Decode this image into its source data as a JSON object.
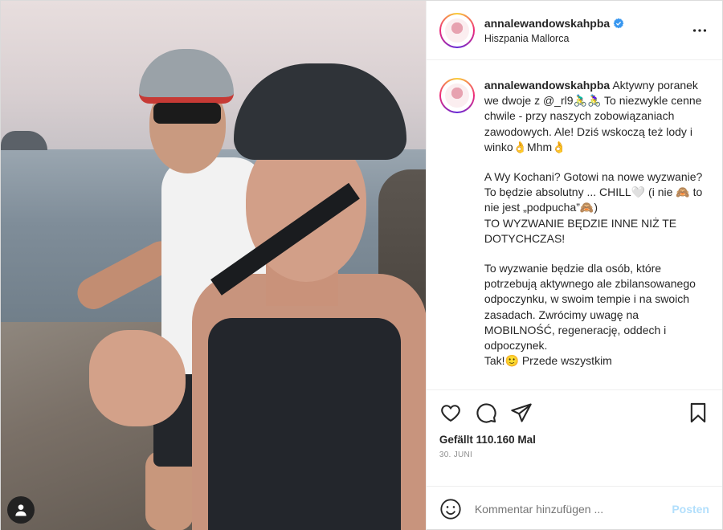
{
  "post": {
    "username": "annalewandowskahpba",
    "location": "Hiszpania Mallorca",
    "verified": true,
    "caption": {
      "username": "annalewandowskahpba",
      "p1": "Aktywny poranek we dwoje z @_rl9🚴‍♂️🚴‍♀️ To niezwykle cenne chwile - przy naszych zobowiązaniach zawodowych. Ale! Dziś wskoczą też lody i winko👌Mhm👌",
      "p2a": "A Wy Kochani? Gotowi na nowe wyzwanie?",
      "p2b": "To będzie absolutny ... CHILL🤍 (i nie 🙈 to nie jest „podpucha”🙈)",
      "p2c": "TO WYZWANIE BĘDZIE INNE NIŻ TE DOTYCHCZAS!",
      "p3": "To wyzwanie będzie dla osób, które potrzebują aktywnego ale zbilansowanego odpoczynku, w swoim tempie i na swoich zasadach. Zwrócimy uwagę na MOBILNOŚĆ, regenerację, oddech i odpoczynek.",
      "p3_cut": "Tak!🙂 Przede wszystkim"
    },
    "likes_text": "Gefällt 110.160 Mal",
    "date": "30. JUNI",
    "comment_placeholder": "Kommentar hinzufügen ...",
    "post_button": "Posten",
    "more_icon": "more-horizontal-icon",
    "icons": [
      "heart-icon",
      "comment-icon",
      "share-icon",
      "bookmark-icon",
      "emoji-icon",
      "user-tag-icon"
    ],
    "colors": {
      "accent_blue": "#0095f6",
      "verified_blue": "#3897f0",
      "post_button_disabled": "#b2dffc",
      "muted": "#8e8e8e"
    }
  }
}
